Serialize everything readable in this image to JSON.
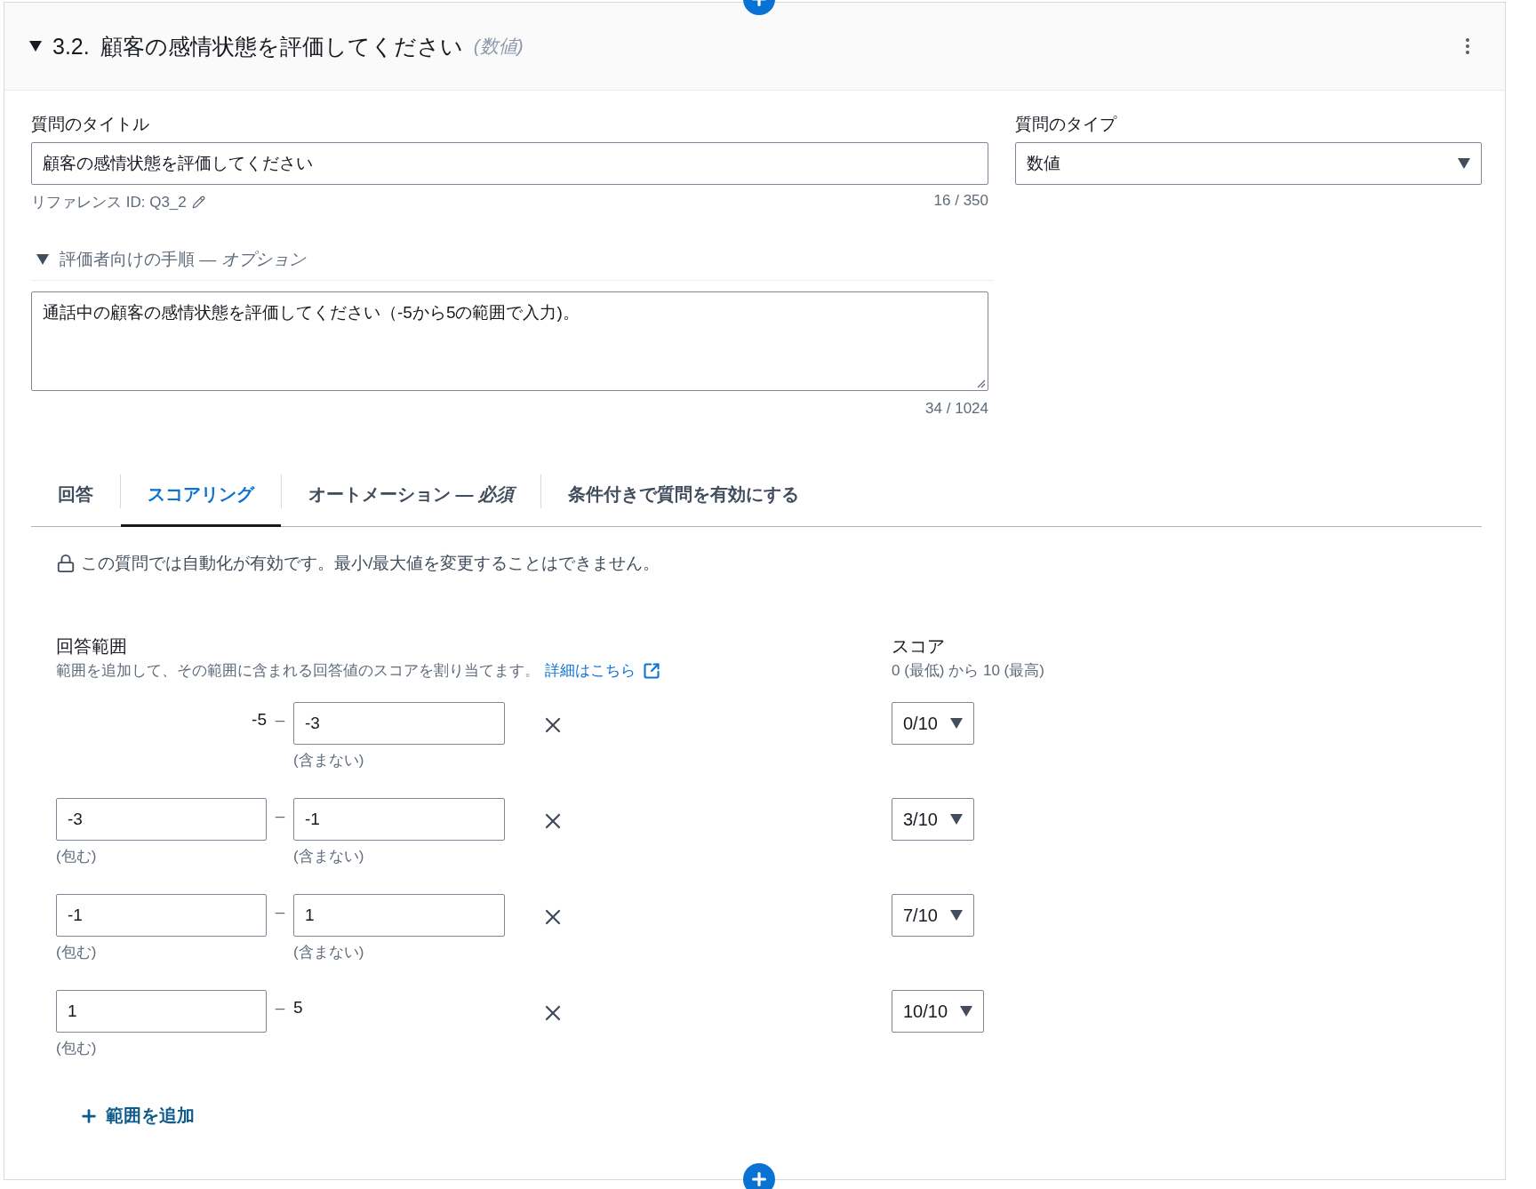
{
  "header": {
    "expanded": true,
    "number": "3.2.",
    "title": "顧客の感情状態を評価してください",
    "type_hint": "(数値)"
  },
  "title_field": {
    "label": "質問のタイトル",
    "value": "顧客の感情状態を評価してください",
    "reference": "リファレンス ID: Q3_2",
    "count": "16 / 350"
  },
  "type_field": {
    "label": "質問のタイプ",
    "value": "数値"
  },
  "instructions": {
    "label": "評価者向けの手順 — *オプション*",
    "expanded": true,
    "value": "通話中の顧客の感情状態を評価してください（-5から5の範囲で入力)。",
    "count": "34 / 1024"
  },
  "tabs": [
    {
      "label": "回答",
      "selected": false
    },
    {
      "label": "スコアリング",
      "selected": true
    },
    {
      "label": "オートメーション — *必須*",
      "selected": false
    },
    {
      "label": "条件付きで質問を有効にする",
      "selected": false
    }
  ],
  "notice": "この質問では自動化が有効です。最小/最大値を変更することはできません。",
  "ranges": {
    "label": "回答範囲",
    "description": "範囲を追加して、その範囲に含まれる回答値のスコアを割り当てます。",
    "link": "詳細はこちら",
    "score_label": "スコア",
    "score_description": "0 (最低) から 10 (最高)",
    "rows": [
      {
        "min": {
          "kind": "text",
          "value": "-5"
        },
        "dash": "–",
        "max": {
          "kind": "field",
          "value": "-3",
          "hint": "(含まない)"
        },
        "score": "0/10"
      },
      {
        "min": {
          "kind": "field",
          "value": "-3",
          "hint": "(包む)"
        },
        "dash": "–",
        "max": {
          "kind": "field",
          "value": "-1",
          "hint": "(含まない)"
        },
        "score": "3/10"
      },
      {
        "min": {
          "kind": "field",
          "value": "-1",
          "hint": "(包む)"
        },
        "dash": "–",
        "max": {
          "kind": "field",
          "value": "1",
          "hint": "(含まない)"
        },
        "score": "7/10"
      },
      {
        "min": {
          "kind": "field",
          "value": "1",
          "hint": "(包む)"
        },
        "dash": "–",
        "max": {
          "kind": "text",
          "value": "5"
        },
        "score": "10/10"
      }
    ]
  },
  "add_range": "範囲を追加"
}
